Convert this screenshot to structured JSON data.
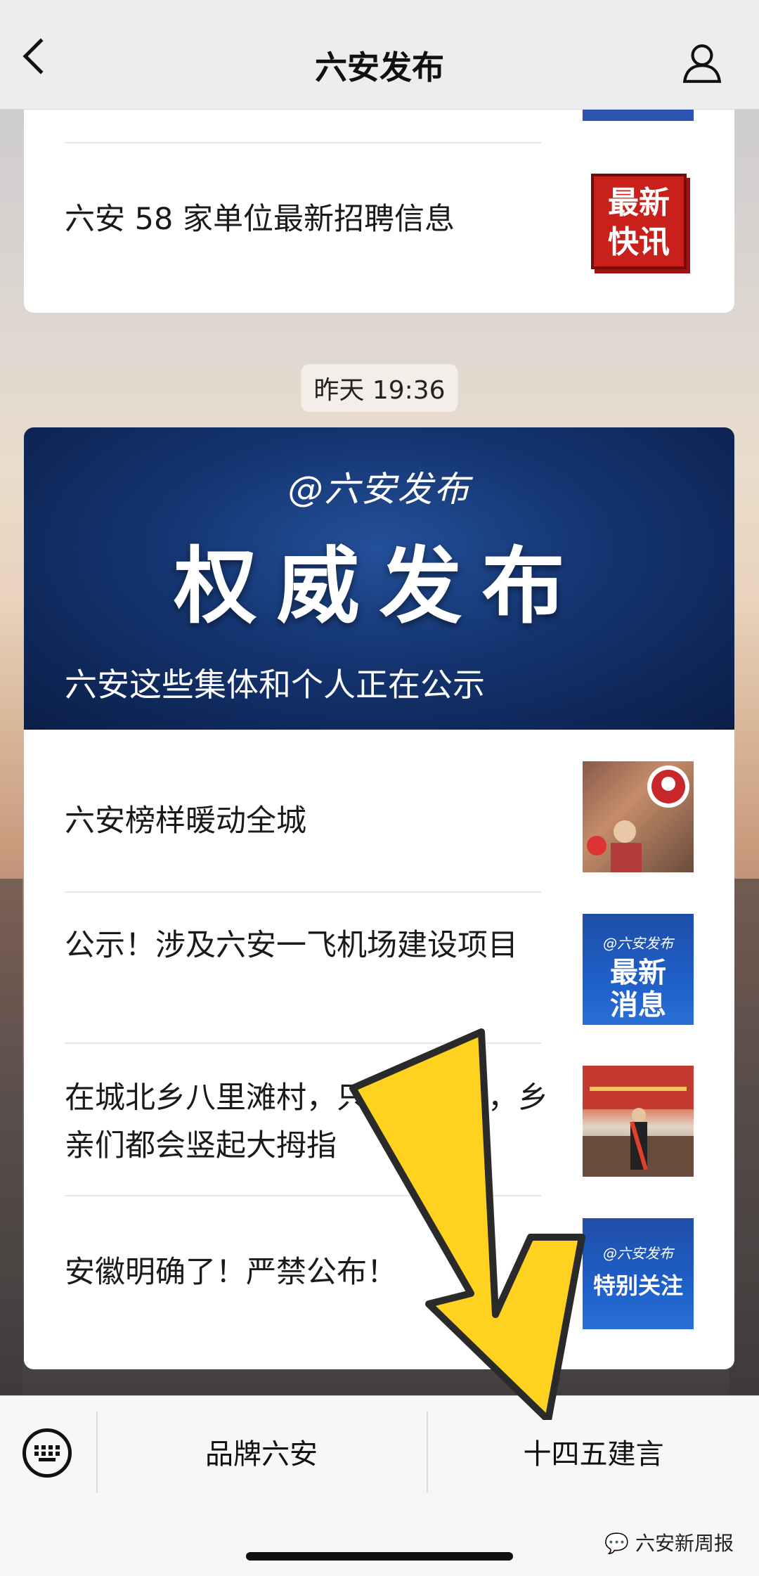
{
  "header": {
    "title": "六安发布"
  },
  "card1": {
    "article_title": "六安 58 家单位最新招聘信息",
    "thumb_text": "最新快讯"
  },
  "timestamp": "昨天 19:36",
  "card2": {
    "banner": {
      "tag": "@六安发布",
      "headline": "权威发布",
      "caption": "六安这些集体和个人正在公示"
    },
    "articles": [
      {
        "title": "六安榜样暖动全城"
      },
      {
        "title": "公示！涉及六安一飞机场建设项目",
        "thumb_tag": "@六安发布",
        "thumb_text": "最新消息"
      },
      {
        "title": "在城北乡八里滩村，只要提起他，乡亲们都会竖起大拇指"
      },
      {
        "title": "安徽明确了！严禁公布！",
        "thumb_tag": "@六安发布",
        "thumb_text": "特别关注"
      }
    ]
  },
  "menu": {
    "item1": "品牌六安",
    "item2": "十四五建言"
  },
  "watermark": "六安新周报",
  "colors": {
    "banner_blue": "#143470",
    "arrow_yellow": "#ffd21f"
  }
}
